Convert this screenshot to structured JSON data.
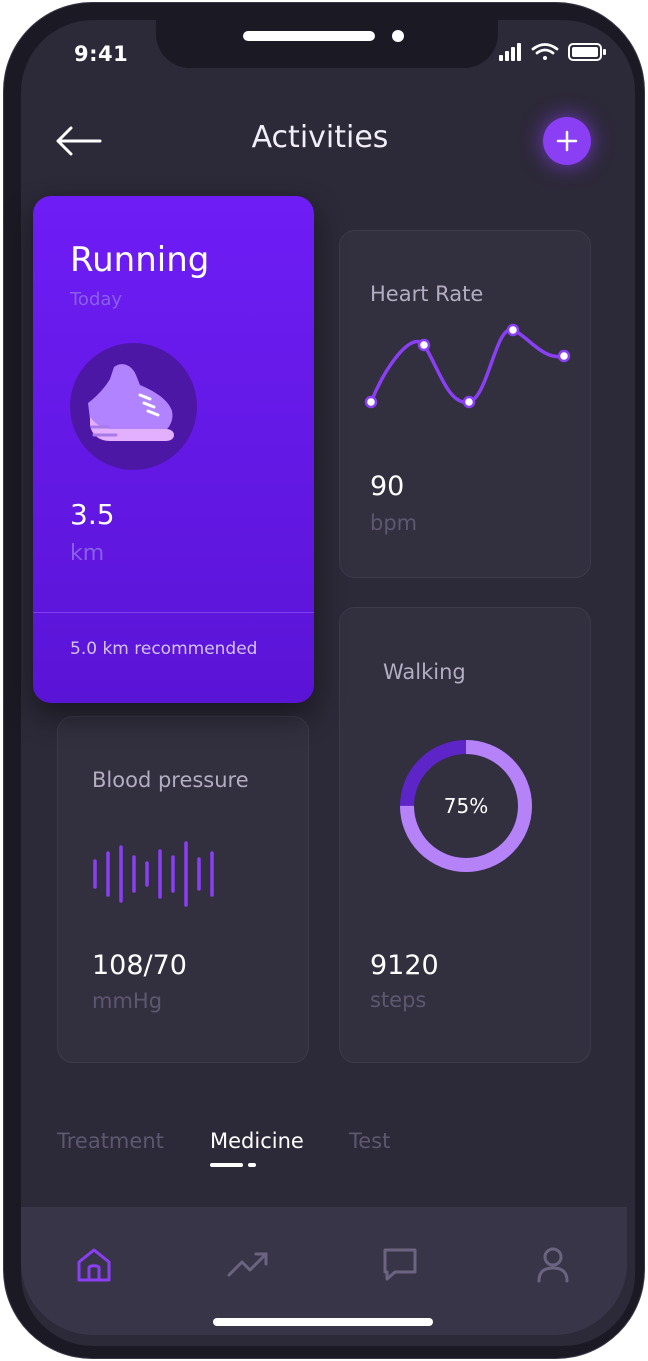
{
  "status": {
    "time": "9:41"
  },
  "header": {
    "title": "Activities"
  },
  "running": {
    "title": "Running",
    "subtitle": "Today",
    "value": "3.5",
    "unit": "km",
    "recommendation": "5.0 km recommended"
  },
  "heart_rate": {
    "title": "Heart Rate",
    "value": "90",
    "unit": "bpm"
  },
  "walking": {
    "title": "Walking",
    "progress_label": "75%",
    "progress_percent": 75,
    "value": "9120",
    "unit": "steps"
  },
  "blood_pressure": {
    "title": "Blood pressure",
    "value": "108/70",
    "unit": "mmHg"
  },
  "tabs": [
    {
      "label": "Treatment",
      "active": false
    },
    {
      "label": "Medicine",
      "active": true
    },
    {
      "label": "Test",
      "active": false
    }
  ],
  "bottom_nav": [
    {
      "icon": "home-icon",
      "active": true
    },
    {
      "icon": "trending-icon",
      "active": false
    },
    {
      "icon": "chat-icon",
      "active": false
    },
    {
      "icon": "user-icon",
      "active": false
    }
  ],
  "colors": {
    "accent": "#8b3ff5",
    "card_running": "#6e1df5",
    "background": "#2c2938",
    "card": "#322f3f",
    "text_muted": "#5d576f"
  }
}
